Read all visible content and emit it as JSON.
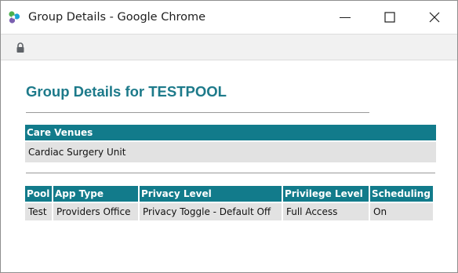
{
  "window": {
    "title": "Group Details - Google Chrome",
    "icons": {
      "app": "chrome-app-icon",
      "minimize": "minimize-icon",
      "maximize": "maximize-icon",
      "close": "close-icon",
      "lock": "lock-icon"
    }
  },
  "page": {
    "title": "Group Details for TESTPOOL",
    "title_color": "#1d7a8a",
    "header_color": "#127b8b"
  },
  "venues": {
    "header": "Care Venues",
    "rows": [
      "Cardiac Surgery Unit"
    ]
  },
  "pool_table": {
    "headers": [
      "Pool",
      "App Type",
      "Privacy Level",
      "Privilege Level",
      "Scheduling"
    ],
    "rows": [
      [
        "Test",
        "Providers Office",
        "Privacy Toggle - Default Off",
        "Full Access",
        "On"
      ]
    ]
  }
}
